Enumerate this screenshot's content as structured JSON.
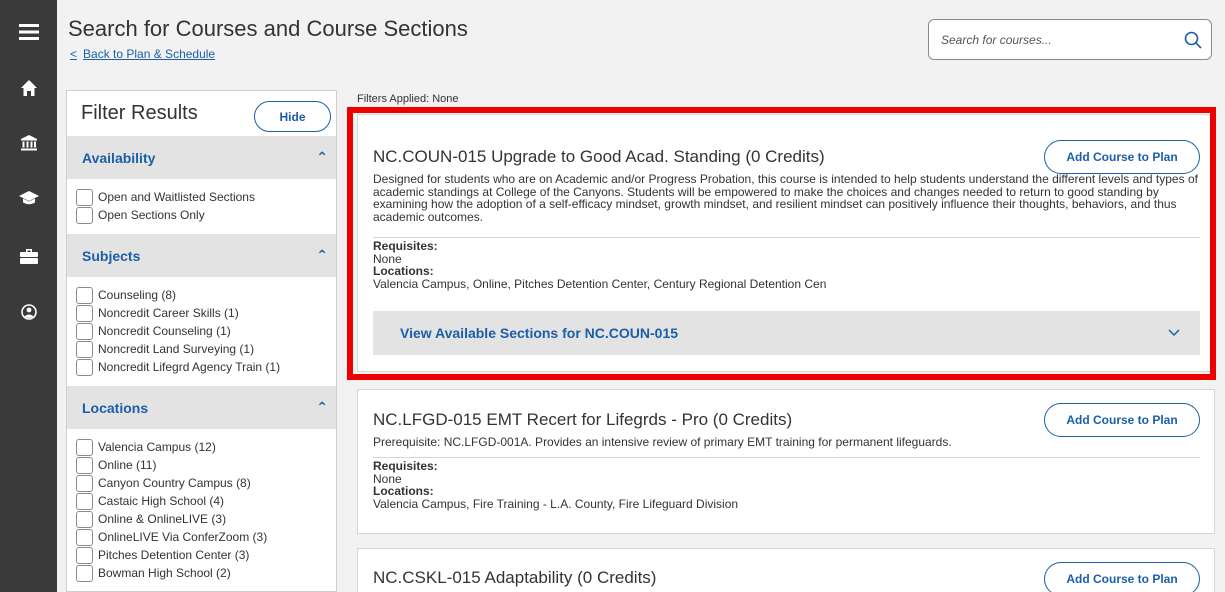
{
  "header": {
    "title": "Search for Courses and Course Sections",
    "back_label": "Back to Plan & Schedule",
    "search_placeholder": "Search for courses..."
  },
  "filter_panel": {
    "title": "Filter Results",
    "hide_label": "Hide",
    "availability": {
      "label": "Availability",
      "options": [
        "Open and Waitlisted Sections",
        "Open Sections Only"
      ]
    },
    "subjects": {
      "label": "Subjects",
      "options": [
        "Counseling (8)",
        "Noncredit Career Skills (1)",
        "Noncredit Counseling (1)",
        "Noncredit Land Surveying (1)",
        "Noncredit Lifegrd Agency Train (1)"
      ]
    },
    "locations": {
      "label": "Locations",
      "options": [
        "Valencia Campus (12)",
        "Online (11)",
        "Canyon Country Campus (8)",
        "Castaic High School (4)",
        "Online & OnlineLIVE (3)",
        "OnlineLIVE Via ConferZoom (3)",
        "Pitches Detention Center (3)",
        "Bowman High School (2)"
      ]
    }
  },
  "main": {
    "filters_applied": "Filters Applied: None",
    "add_label": "Add Course to Plan",
    "requisites_label": "Requisites:",
    "locations_label": "Locations:",
    "courses": [
      {
        "title": "NC.COUN-015 Upgrade to Good Acad. Standing (0 Credits)",
        "description": "Designed for students who are on Academic and/or Progress Probation, this course is intended to help students understand the different levels and types of academic standings at College of the Canyons. Students will be empowered to make the choices and changes needed to return to good standing by examining how the adoption of a self-efficacy mindset, growth mindset, and resilient mindset can positively influence their thoughts, behaviors, and thus academic outcomes.",
        "requisites": "None",
        "locations": "Valencia Campus, Online, Pitches Detention Center, Century Regional Detention Cen",
        "sections_label": "View Available Sections for NC.COUN-015"
      },
      {
        "title": "NC.LFGD-015 EMT Recert for Lifegrds - Pro (0 Credits)",
        "description": "Prerequisite: NC.LFGD-001A. Provides an intensive review of primary EMT training for permanent lifeguards.",
        "requisites": "None",
        "locations": "Valencia Campus, Fire Training - L.A. County, Fire Lifeguard Division"
      },
      {
        "title": "NC.CSKL-015 Adaptability (0 Credits)"
      }
    ]
  },
  "colors": {
    "accent": "#1b5fa8",
    "rail": "#3a3a3a",
    "highlight": "#ee0000"
  }
}
